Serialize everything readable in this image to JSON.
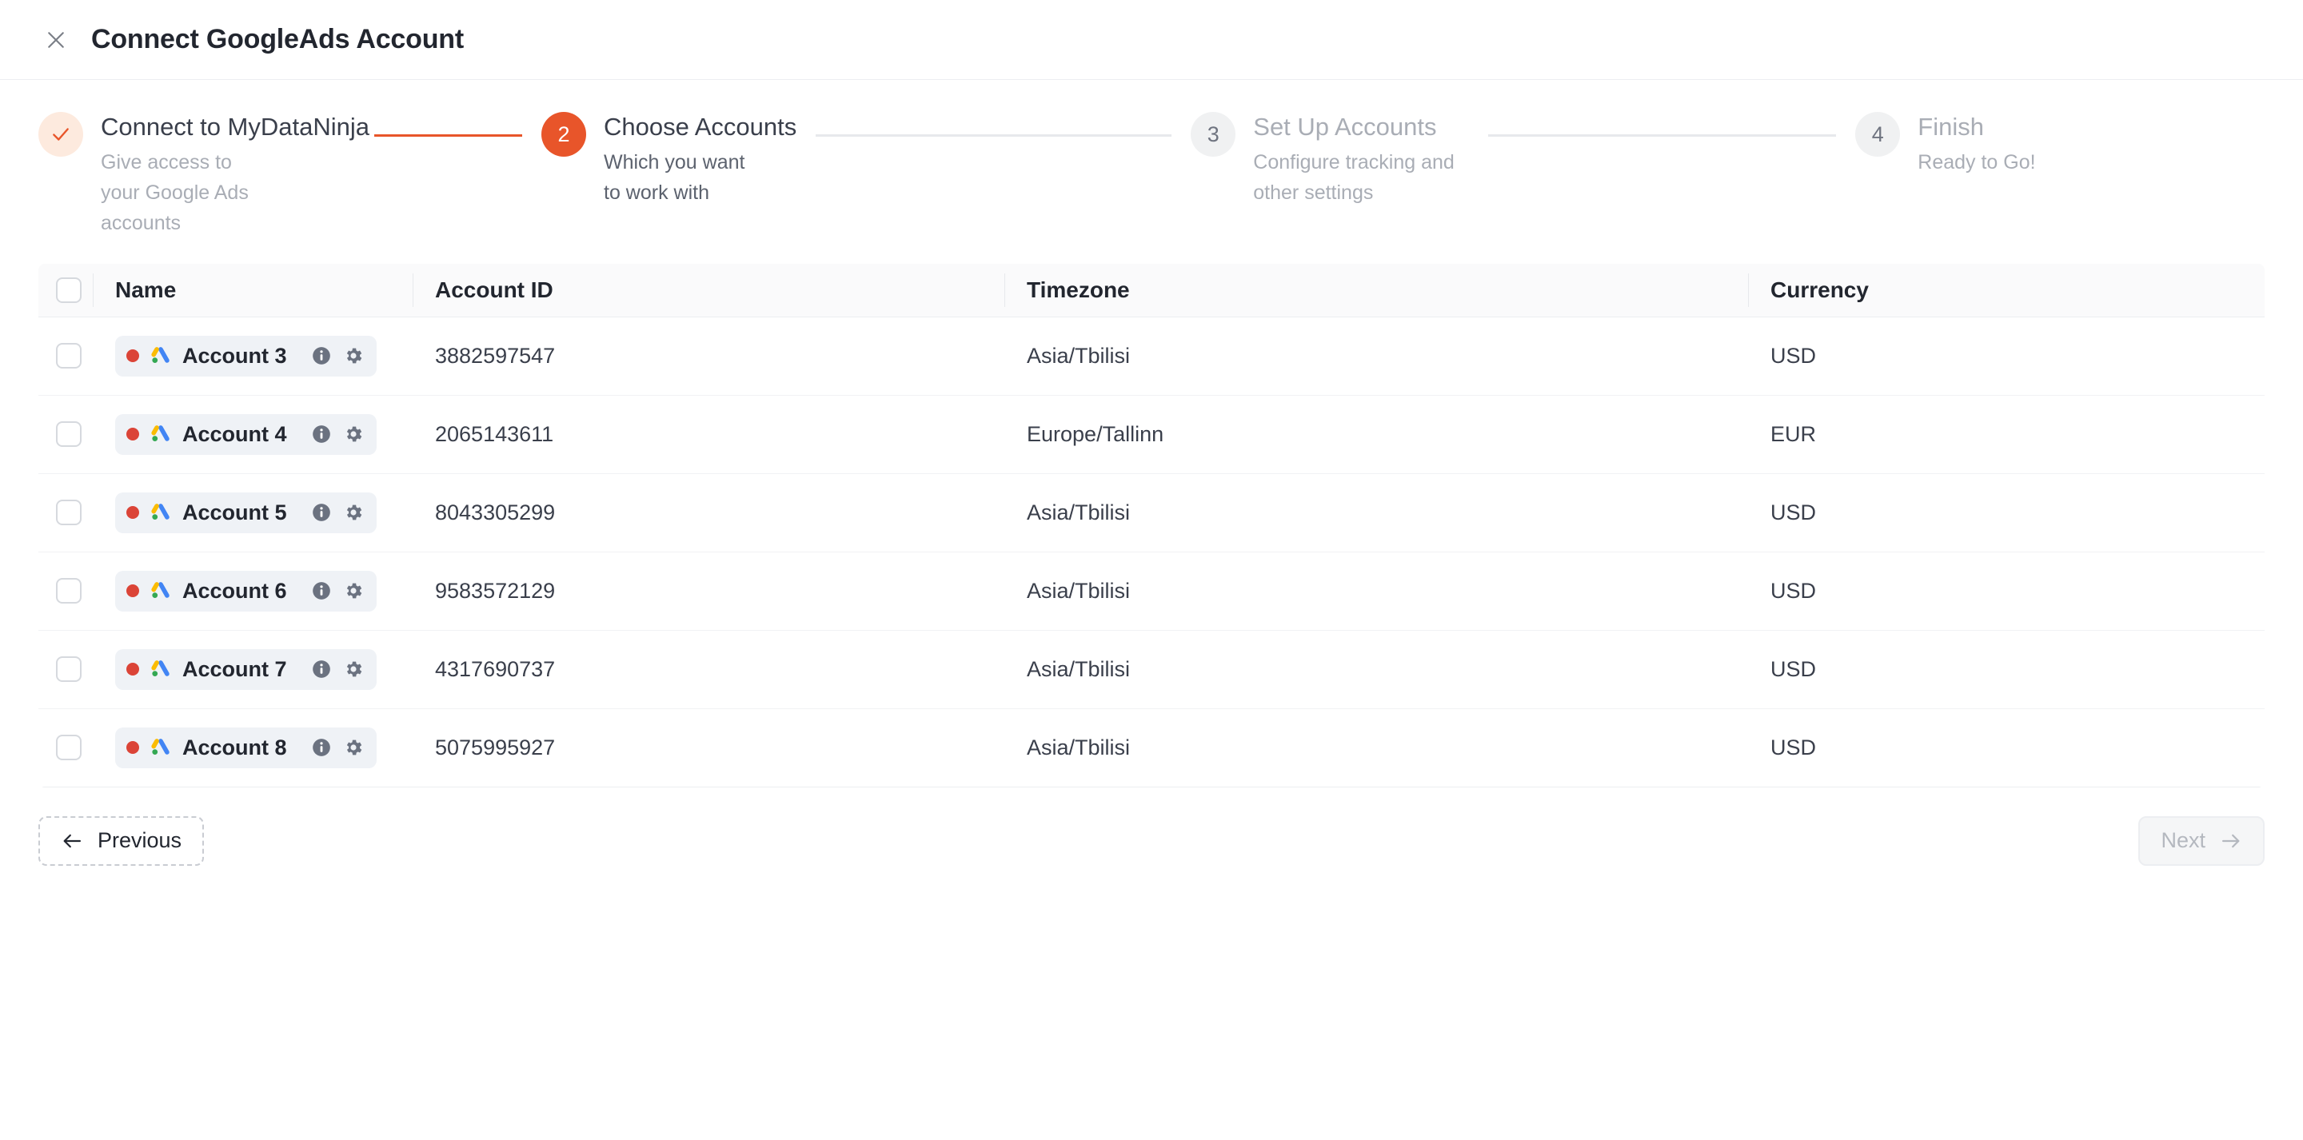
{
  "header": {
    "title": "Connect GoogleAds Account",
    "close_icon": "close-icon"
  },
  "colors": {
    "accent": "#e8552a",
    "accent_soft": "#fdeade",
    "idle_bubble": "#f0f1f2",
    "google_red": "#DB4437",
    "google_blue": "#4285F4",
    "google_yellow": "#FBBC04",
    "google_green": "#34A853",
    "icon_slate": "#6b7280"
  },
  "stepper": {
    "steps": [
      {
        "number": "1",
        "state": "done",
        "marker": "✓",
        "title": "Connect to MyDataNinja",
        "subtitle": "Give access to your Google Ads accounts"
      },
      {
        "number": "2",
        "state": "active",
        "marker": "2",
        "title": "Choose Accounts",
        "subtitle": "Which you want to work with"
      },
      {
        "number": "3",
        "state": "idle",
        "marker": "3",
        "title": "Set Up Accounts",
        "subtitle": "Configure tracking and other settings"
      },
      {
        "number": "4",
        "state": "idle",
        "marker": "4",
        "title": "Finish",
        "subtitle": "Ready to Go!"
      }
    ]
  },
  "table": {
    "columns": [
      "Name",
      "Account ID",
      "Timezone",
      "Currency"
    ],
    "select_all_checked": false,
    "rows": [
      {
        "name": "Account 3",
        "account_id": "3882597547",
        "timezone": "Asia/Tbilisi",
        "currency": "USD",
        "checked": false
      },
      {
        "name": "Account 4",
        "account_id": "2065143611",
        "timezone": "Europe/Tallinn",
        "currency": "EUR",
        "checked": false
      },
      {
        "name": "Account 5",
        "account_id": "8043305299",
        "timezone": "Asia/Tbilisi",
        "currency": "USD",
        "checked": false
      },
      {
        "name": "Account 6",
        "account_id": "9583572129",
        "timezone": "Asia/Tbilisi",
        "currency": "USD",
        "checked": false
      },
      {
        "name": "Account 7",
        "account_id": "4317690737",
        "timezone": "Asia/Tbilisi",
        "currency": "USD",
        "checked": false
      },
      {
        "name": "Account 8",
        "account_id": "5075995927",
        "timezone": "Asia/Tbilisi",
        "currency": "USD",
        "checked": false
      }
    ],
    "row_icons": [
      "info-icon",
      "gear-icon"
    ]
  },
  "footer": {
    "previous_label": "Previous",
    "next_label": "Next",
    "next_disabled": true
  }
}
